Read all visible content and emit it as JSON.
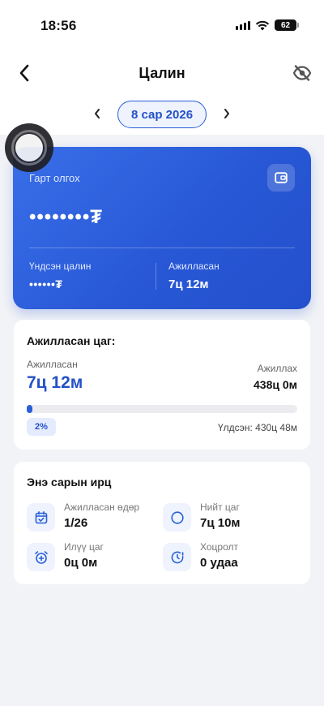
{
  "status_bar": {
    "time": "18:56",
    "battery": "62"
  },
  "header": {
    "title": "Цалин"
  },
  "month_selector": {
    "label": "8 сар 2026"
  },
  "salary_card": {
    "label": "Гарт олгох",
    "amount": "••••••••₮",
    "base_label": "Үндсэн цалин",
    "base_value": "••••••₮",
    "worked_label": "Ажилласан",
    "worked_value": "7ц 12м"
  },
  "hours_panel": {
    "title": "Ажилласан цаг:",
    "worked_label": "Ажилласан",
    "worked_value": "7ц 12м",
    "required_label": "Ажиллах",
    "required_value": "438ц 0м",
    "progress_percent": 2,
    "percent_label": "2%",
    "remaining": "Үлдсэн: 430ц 48м"
  },
  "attendance_panel": {
    "title": "Энэ сарын ирц",
    "items": [
      {
        "icon": "calendar-check-icon",
        "label": "Ажилласан өдөр",
        "value": "1/26"
      },
      {
        "icon": "moon-clock-icon",
        "label": "Нийт цаг",
        "value": "7ц 10м"
      },
      {
        "icon": "alarm-plus-icon",
        "label": "Илүү цаг",
        "value": "0ц 0м"
      },
      {
        "icon": "late-clock-icon",
        "label": "Хоцролт",
        "value": "0 удаа"
      }
    ]
  },
  "colors": {
    "accent": "#2a5fd8",
    "card_start": "#3a6fe9",
    "card_end": "#2450cc",
    "background": "#f2f3f6"
  }
}
